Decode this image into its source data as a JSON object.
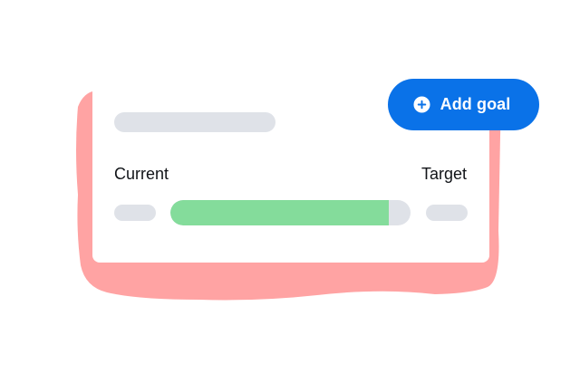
{
  "card": {
    "current_label": "Current",
    "target_label": "Target",
    "progress": 0.91
  },
  "add_goal_button": {
    "label": "Add goal",
    "icon": "plus-circle-icon"
  },
  "colors": {
    "blob": "#ffa3a3",
    "button": "#0a72e8",
    "progress_fill": "#84dc9b",
    "placeholder": "#dfe2e8"
  }
}
